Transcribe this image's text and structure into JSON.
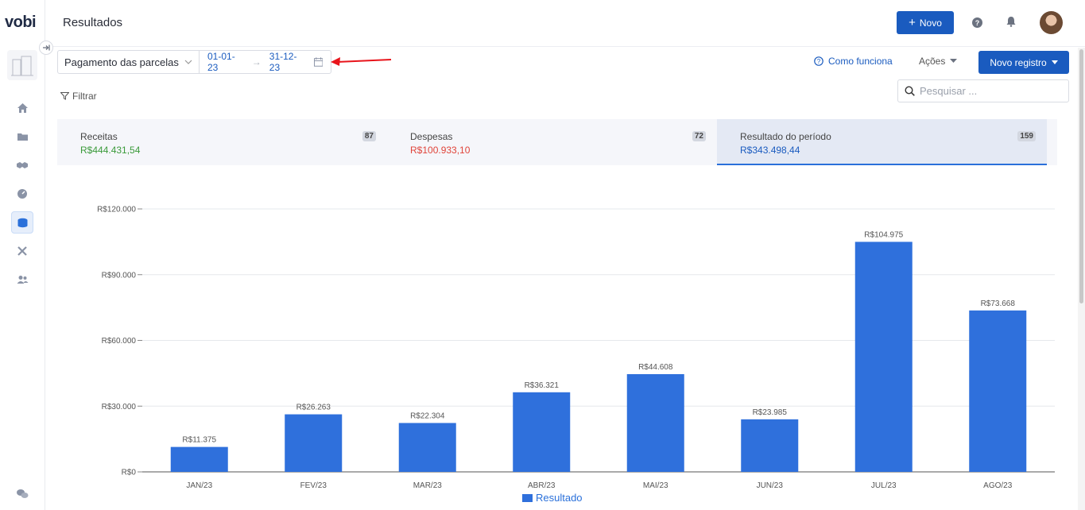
{
  "app": {
    "logo": "vobi",
    "collapse_icon": "arrow-right-bar-icon"
  },
  "header": {
    "title": "Resultados",
    "new_button": "Novo",
    "new_button_icon": "+"
  },
  "sidebar": {
    "items": [
      {
        "name": "home-icon"
      },
      {
        "name": "folder-icon"
      },
      {
        "name": "handshake-icon"
      },
      {
        "name": "gauge-icon"
      },
      {
        "name": "coins-icon",
        "active": true
      },
      {
        "name": "tools-icon"
      },
      {
        "name": "users-icon"
      },
      {
        "name": "chat-icon"
      }
    ]
  },
  "filters": {
    "mode": "Pagamento das parcelas",
    "date_start": "01-01-23",
    "date_end": "31-12-23",
    "arrow": "→",
    "filter_label": "Filtrar"
  },
  "actions": {
    "como_funciona": "Como funciona",
    "acoes": "Ações",
    "novo_registro": "Novo registro",
    "search_placeholder": "Pesquisar ..."
  },
  "cards": [
    {
      "label": "Receitas",
      "value": "R$444.431,54",
      "count": "87",
      "color": "#3a9a3a"
    },
    {
      "label": "Despesas",
      "value": "R$100.933,10",
      "count": "72",
      "color": "#e0443a"
    },
    {
      "label": "Resultado do período",
      "value": "R$343.498,44",
      "count": "159",
      "color": "#1a5bbf"
    }
  ],
  "chart_data": {
    "type": "bar",
    "categories": [
      "JAN/23",
      "FEV/23",
      "MAR/23",
      "ABR/23",
      "MAI/23",
      "JUN/23",
      "JUL/23",
      "AGO/23"
    ],
    "series": [
      {
        "name": "Resultado",
        "values": [
          11375,
          26263,
          22304,
          36321,
          44608,
          23985,
          104975,
          73668
        ],
        "labels": [
          "R$11.375",
          "R$26.263",
          "R$22.304",
          "R$36.321",
          "R$44.608",
          "R$23.985",
          "R$104.975",
          "R$73.668"
        ]
      }
    ],
    "yticks": [
      0,
      30000,
      60000,
      90000,
      120000
    ],
    "ytick_labels": [
      "R$0",
      "R$30.000",
      "R$60.000",
      "R$90.000",
      "R$120.000"
    ],
    "ylim": [
      0,
      120000
    ],
    "grid": true,
    "legend": "bottom-center",
    "bar_color": "#2f70dc"
  }
}
